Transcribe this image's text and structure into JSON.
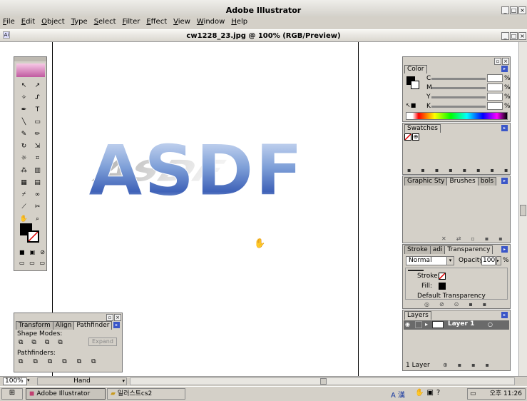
{
  "app": {
    "title": "Adobe Illustrator"
  },
  "menu": [
    "File",
    "Edit",
    "Object",
    "Type",
    "Select",
    "Filter",
    "Effect",
    "View",
    "Window",
    "Help"
  ],
  "document": {
    "title": "cw1228_23.jpg @ 100% (RGB/Preview)",
    "artwork_text": "ASDF"
  },
  "color_panel": {
    "tab": "Color",
    "channels": [
      {
        "label": "C",
        "unit": "%"
      },
      {
        "label": "M",
        "unit": "%"
      },
      {
        "label": "Y",
        "unit": "%"
      },
      {
        "label": "K",
        "unit": "%"
      }
    ]
  },
  "swatches_panel": {
    "tab": "Swatches"
  },
  "brushes_panel": {
    "tabs": [
      "Graphic Sty",
      "Brushes",
      "bols"
    ]
  },
  "transparency_panel": {
    "tabs": [
      "Stroke",
      "adi",
      "Transparency"
    ],
    "blend_mode": "Normal",
    "opacity_label": "Opacity:",
    "opacity_value": "100",
    "opacity_unit": "%",
    "stroke_label": "Stroke:",
    "fill_label": "Fill:",
    "default_label": "Default Transparency"
  },
  "layers_panel": {
    "tab": "Layers",
    "layer_name": "Layer 1",
    "footer": "1 Layer"
  },
  "pathfinder_panel": {
    "tabs": [
      "Transform",
      "Align",
      "Pathfinder"
    ],
    "shape_modes_label": "Shape Modes:",
    "expand_label": "Expand",
    "pathfinders_label": "Pathfinders:"
  },
  "status": {
    "zoom": "100%",
    "tool": "Hand"
  },
  "taskbar": {
    "app": "Adobe Illustrator",
    "folder": "일러스트cs2",
    "ime": "A 漢",
    "clock": "오후 11:26"
  }
}
